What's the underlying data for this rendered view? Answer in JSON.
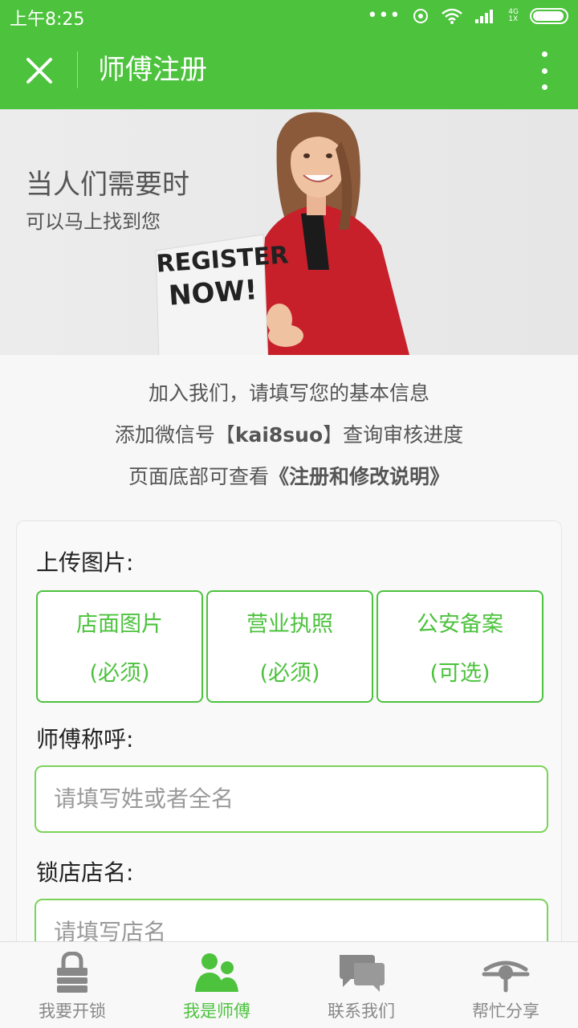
{
  "status_bar": {
    "time": "上午8:25",
    "network_label_top": "4G",
    "network_label_bottom": "1X",
    "battery_level": 0.95
  },
  "header": {
    "title": "师傅注册",
    "close_icon": "close-icon",
    "more_icon": "more-vertical-icon"
  },
  "banner": {
    "headline": "当人们需要时",
    "subline": "可以马上找到您",
    "sign_line1": "REGISTER",
    "sign_line2": "NOW!"
  },
  "intro": {
    "line1": "加入我们，请填写您的基本信息",
    "line2_prefix": "添加微信号【",
    "line2_wechat": "kai8suo",
    "line2_suffix": "】查询审核进度",
    "line3_prefix": "页面底部可查看",
    "line3_link": "《注册和修改说明》"
  },
  "form": {
    "upload_label": "上传图片:",
    "uploads": [
      {
        "label": "店面图片",
        "note": "(必须)"
      },
      {
        "label": "营业执照",
        "note": "(必须)"
      },
      {
        "label": "公安备案",
        "note": "(可选)"
      }
    ],
    "name_label": "师傅称呼:",
    "name_placeholder": "请填写姓或者全名",
    "shop_label": "锁店店名:",
    "shop_placeholder": "请填写店名"
  },
  "tabs": [
    {
      "label": "我要开锁",
      "icon": "lock-icon",
      "active": false
    },
    {
      "label": "我是师傅",
      "icon": "users-icon",
      "active": true
    },
    {
      "label": "联系我们",
      "icon": "chat-icon",
      "active": false
    },
    {
      "label": "帮忙分享",
      "icon": "share-icon",
      "active": false
    }
  ],
  "colors": {
    "brand_green": "#4cc23d",
    "inactive_gray": "#888888"
  }
}
